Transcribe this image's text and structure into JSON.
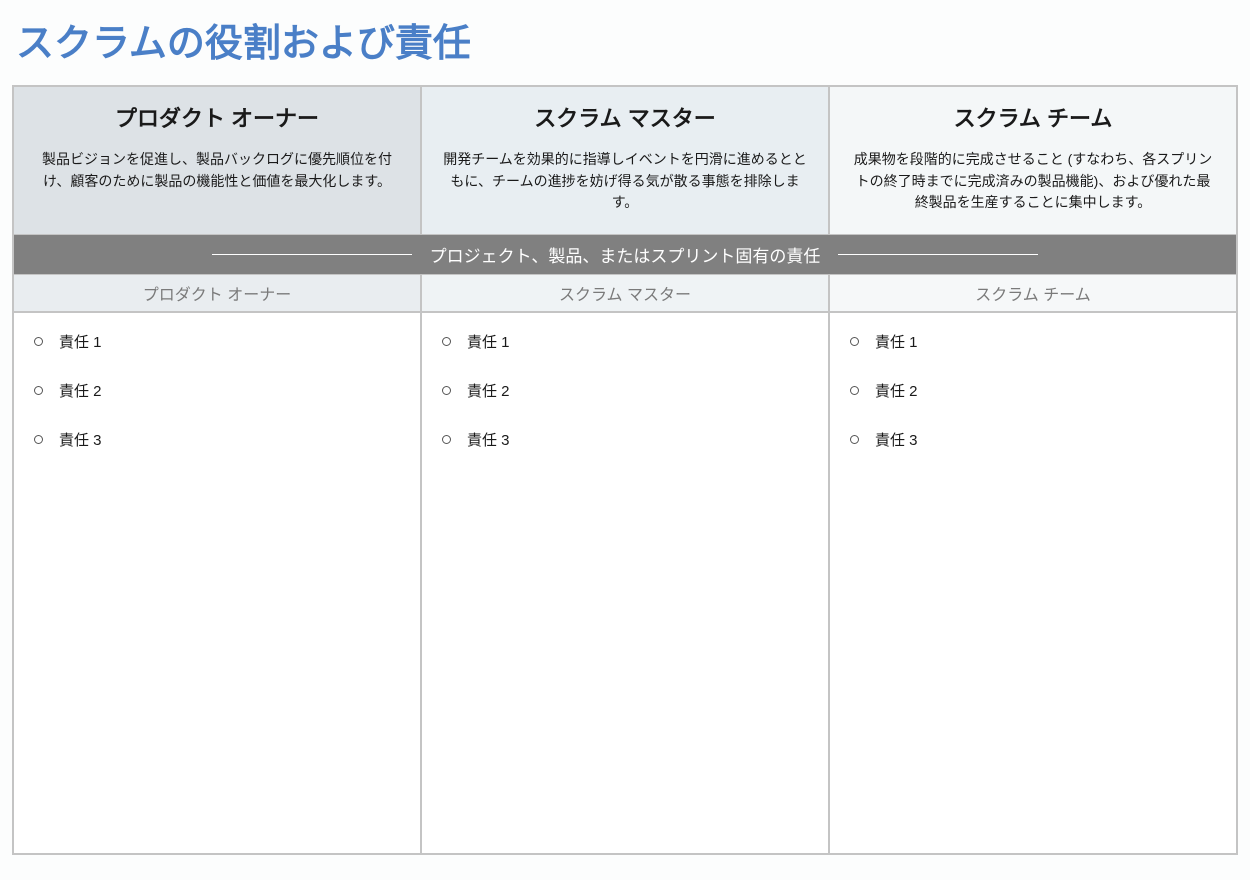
{
  "title": "スクラムの役割および責任",
  "roles": [
    {
      "name": "プロダクト オーナー",
      "description": "製品ビジョンを促進し、製品バックログに優先順位を付け、顧客のために製品の機能性と価値を最大化します。"
    },
    {
      "name": "スクラム マスター",
      "description": "開発チームを効果的に指導しイベントを円滑に進めるとともに、チームの進捗を妨げ得る気が散る事態を排除します。"
    },
    {
      "name": "スクラム チーム",
      "description": "成果物を段階的に完成させること (すなわち、各スプリントの終了時までに完成済みの製品機能)、および優れた最終製品を生産することに集中します。"
    }
  ],
  "banner": "プロジェクト、製品、またはスプリント固有の責任",
  "subheaders": [
    "プロダクト オーナー",
    "スクラム マスター",
    "スクラム チーム"
  ],
  "responsibilities": [
    [
      "責任 1",
      "責任 2",
      "責任 3"
    ],
    [
      "責任 1",
      "責任 2",
      "責任 3"
    ],
    [
      "責任 1",
      "責任 2",
      "責任 3"
    ]
  ]
}
